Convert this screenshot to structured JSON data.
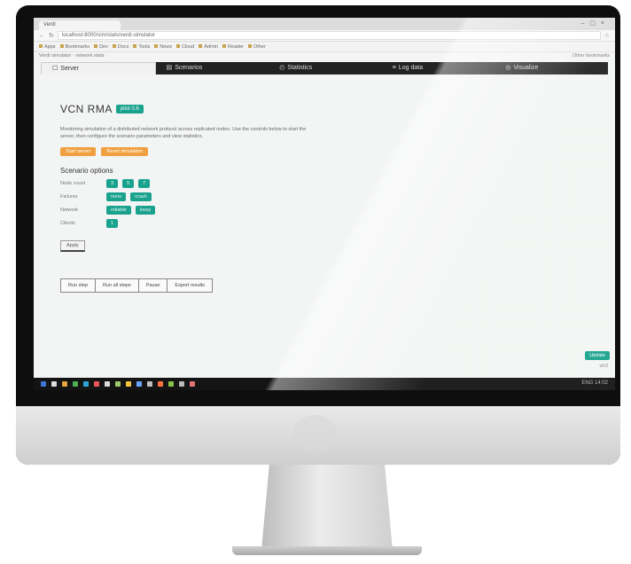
{
  "browser": {
    "tab_title": "Verdi",
    "url": "localhost:8000/sim/stats/verdi-simulator",
    "bookmarks": [
      "Apps",
      "Bookmarks",
      "Dev",
      "Docs",
      "Tools",
      "News",
      "Cloud",
      "Admin",
      "Reader",
      "Other"
    ],
    "subbar_left": "Verdi simulator · network stats",
    "subbar_right": "Other bookmarks"
  },
  "nav": {
    "tabs": [
      {
        "label": "Server",
        "icon": "☐"
      },
      {
        "label": "Scenarios",
        "icon": "▤"
      },
      {
        "label": "Statistics",
        "icon": "◴"
      },
      {
        "label": "Log data",
        "icon": "≡"
      },
      {
        "label": "Visualize",
        "icon": "◎"
      }
    ]
  },
  "main": {
    "title": "VCN RMA",
    "badge": "pilot 0.6",
    "description": "Monitoring simulation of a distributed network protocol across replicated nodes. Use the controls below to start the server, then configure the scenario parameters and view statistics.",
    "action_buttons": [
      "Start server",
      "Reset simulation"
    ],
    "section_title": "Scenario options",
    "option_rows": [
      {
        "label": "Node count",
        "chips": [
          "3",
          "5",
          "7"
        ]
      },
      {
        "label": "Failures",
        "chips": [
          "none",
          "crash"
        ]
      },
      {
        "label": "Network",
        "chips": [
          "reliable",
          "lossy"
        ]
      },
      {
        "label": "Clients",
        "chips": [
          "1"
        ]
      }
    ],
    "apply_button": "Apply",
    "bottom_buttons": [
      "Run step",
      "Run all steps",
      "Pause",
      "Export results"
    ]
  },
  "floating": {
    "button": "Update",
    "meta": "v0.6"
  },
  "taskbar": {
    "clock": "ENG 14:02"
  },
  "colors": {
    "accent": "#1aa28e",
    "orange": "#f0a040",
    "navbar": "#222222"
  }
}
